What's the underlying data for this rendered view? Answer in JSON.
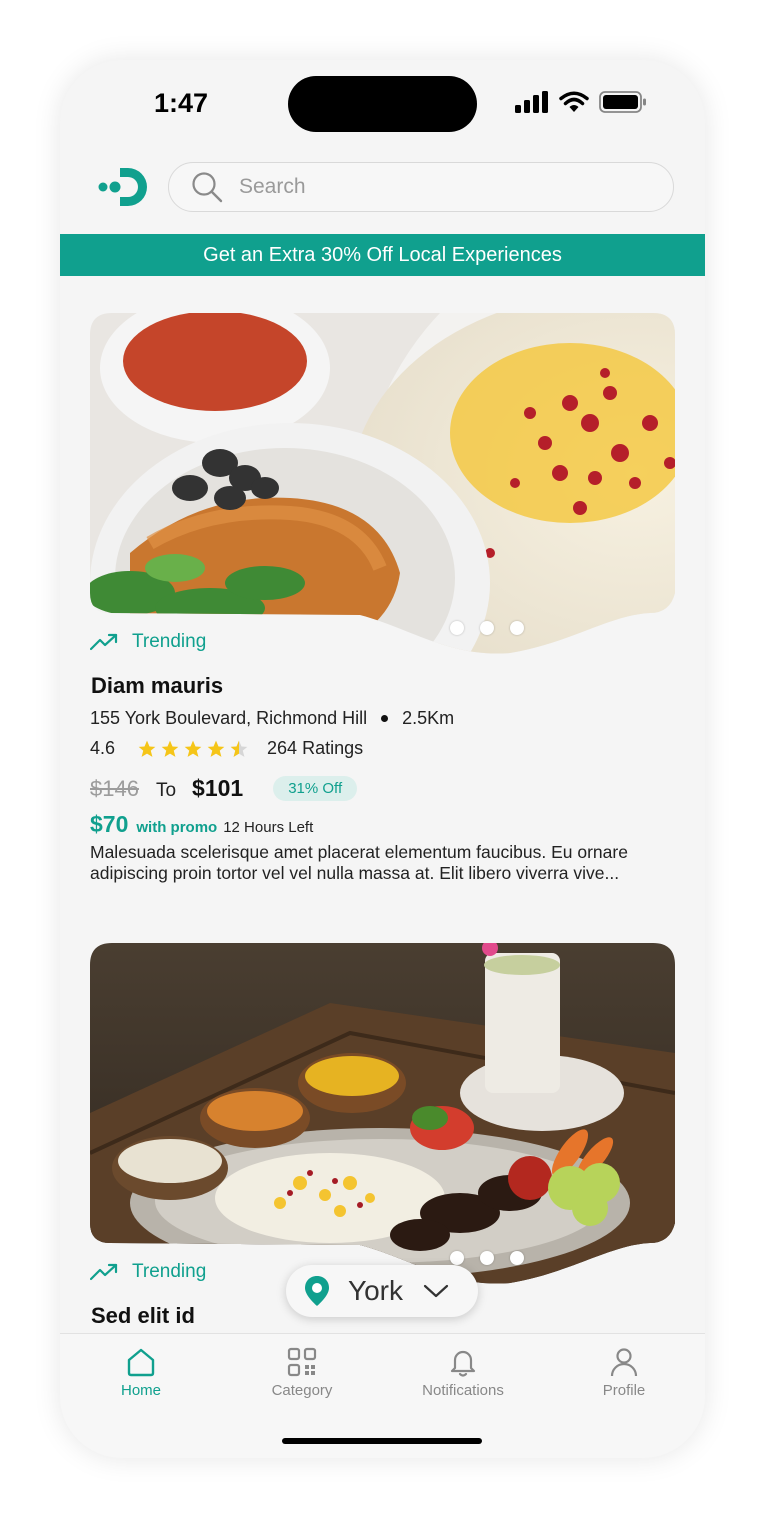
{
  "status_bar": {
    "time": "1:47"
  },
  "search": {
    "placeholder": "Search"
  },
  "promo_banner": "Get an Extra 30% Off Local Experiences",
  "listings": [
    {
      "badge": "Trending",
      "title": "Diam mauris",
      "address": "155 York Boulevard, Richmond Hill",
      "distance": "2.5Km",
      "rating": "4.6",
      "rating_stars": 4.5,
      "ratings_count": "264 Ratings",
      "old_price": "$146",
      "to_label": "To",
      "new_price": "$101",
      "discount": "31% Off",
      "promo_price": "$70",
      "promo_label": "with promo",
      "time_left": "12 Hours Left",
      "description": "Malesuada scelerisque amet placerat elementum faucibus. Eu ornare adipiscing proin tortor vel vel nulla massa at. Elit libero viverra vive..."
    },
    {
      "badge": "Trending",
      "title": "Sed elit id"
    }
  ],
  "location_selector": {
    "value": "York"
  },
  "tabs": [
    {
      "label": "Home",
      "icon": "home-icon",
      "active": true
    },
    {
      "label": "Category",
      "icon": "qr-grid-icon",
      "active": false
    },
    {
      "label": "Notifications",
      "icon": "bell-icon",
      "active": false
    },
    {
      "label": "Profile",
      "icon": "person-icon",
      "active": false
    }
  ],
  "colors": {
    "accent": "#10a08e",
    "star": "#f5c518"
  }
}
